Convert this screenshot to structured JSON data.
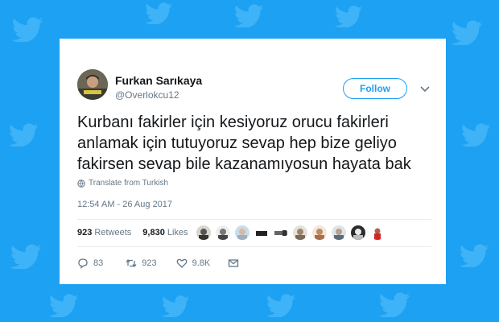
{
  "tweet": {
    "author_name": "Furkan Sarıkaya",
    "author_handle": "@Overlokcu12",
    "follow_label": "Follow",
    "text_lines": [
      "Kurbanı fakirler için kesiyoruz orucu fakirleri",
      "anlamak için tutuyoruz sevap hep bize geliyo",
      "fakirsen sevap bile kazanamıyosun hayata bak"
    ],
    "translate_label": "Translate from Turkish",
    "timestamp": "12:54 AM - 26 Aug 2017",
    "retweets_count": "923",
    "retweets_label": "Retweets",
    "likes_count": "9,830",
    "likes_label": "Likes",
    "reply_count": "83",
    "retweet_action_count": "923",
    "like_action_count": "9.8K"
  },
  "colors": {
    "background": "#1da1f2",
    "accent": "#1da1f2",
    "text": "#14171a",
    "muted": "#657786"
  },
  "icons": [
    "twitter-bird-icon",
    "chevron-down-icon",
    "globe-icon",
    "reply-icon",
    "retweet-icon",
    "heart-icon",
    "mail-icon"
  ]
}
